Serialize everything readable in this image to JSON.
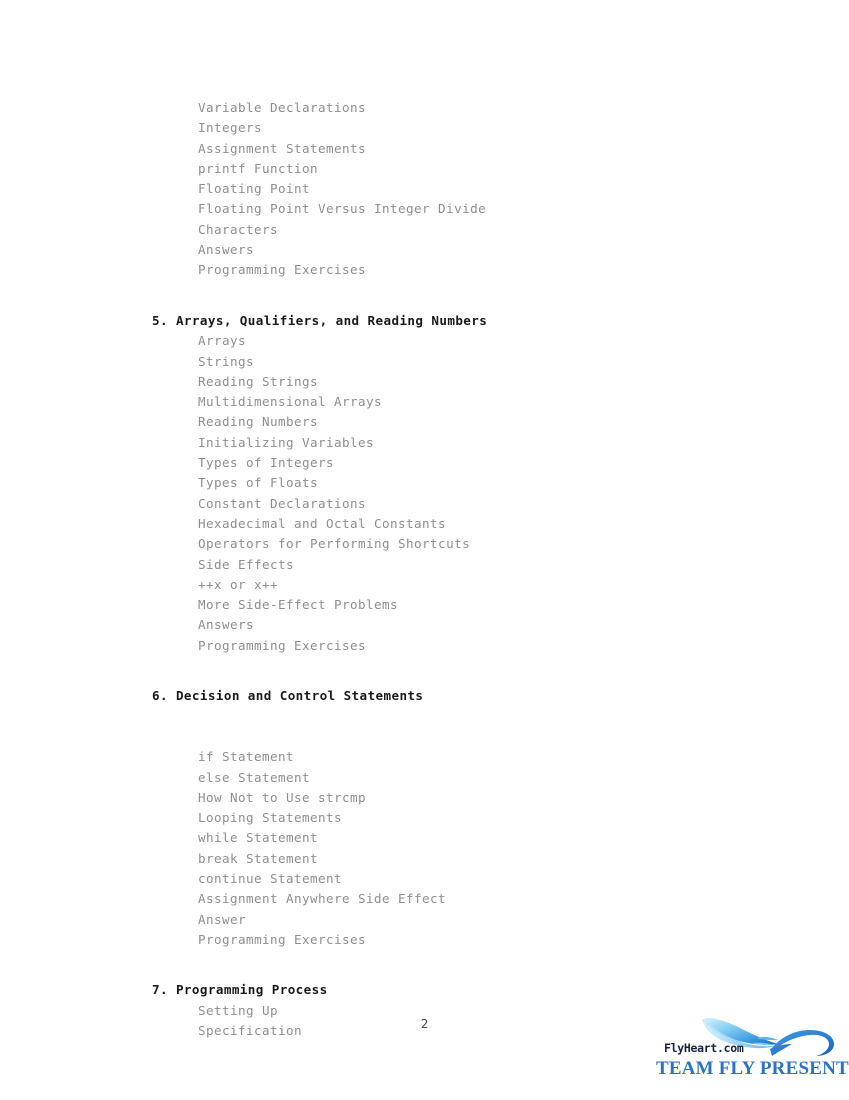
{
  "document": {
    "page_number": "2",
    "sections": [
      {
        "type": "entries",
        "items": [
          "Variable Declarations",
          "Integers",
          "Assignment Statements",
          "printf Function",
          "Floating Point",
          "Floating Point Versus Integer Divide",
          "Characters",
          "Answers",
          "Programming Exercises"
        ]
      },
      {
        "type": "chapter",
        "heading": "5. Arrays, Qualifiers, and Reading Numbers",
        "items": [
          "Arrays",
          "Strings",
          "Reading Strings",
          "Multidimensional Arrays",
          "Reading Numbers",
          "Initializing Variables",
          "Types of Integers",
          "Types of Floats",
          "Constant Declarations",
          "Hexadecimal and Octal Constants",
          "Operators for Performing Shortcuts",
          "Side Effects",
          "++x or x++",
          "More Side-Effect Problems",
          "Answers",
          "Programming Exercises"
        ]
      },
      {
        "type": "chapter",
        "heading": "6. Decision and Control Statements",
        "extra_gap": true,
        "items": [
          "if Statement",
          "else Statement",
          "How Not to Use strcmp",
          "Looping Statements",
          "while Statement",
          "break Statement",
          "continue Statement",
          "Assignment Anywhere Side Effect",
          "Answer",
          "Programming Exercises"
        ]
      },
      {
        "type": "chapter",
        "heading": "7. Programming Process",
        "items": [
          "Setting Up",
          "Specification"
        ]
      }
    ]
  },
  "footer": {
    "logo_wordmark": "FlyHeart.com",
    "logo_tagline": "TEAM FLY PRESENTS",
    "logo_icon": "swoosh-wave-icon",
    "accent_color": "#2a72c6",
    "wordmark_color": "#14233f",
    "swoosh_light": "#bfe9fb",
    "swoosh_mid": "#4aa8e8",
    "swoosh_dark": "#1f6fc4"
  },
  "style": {
    "entry_color": "#8e8e8e",
    "heading_color": "#1a1a1a",
    "background": "#ffffff"
  }
}
